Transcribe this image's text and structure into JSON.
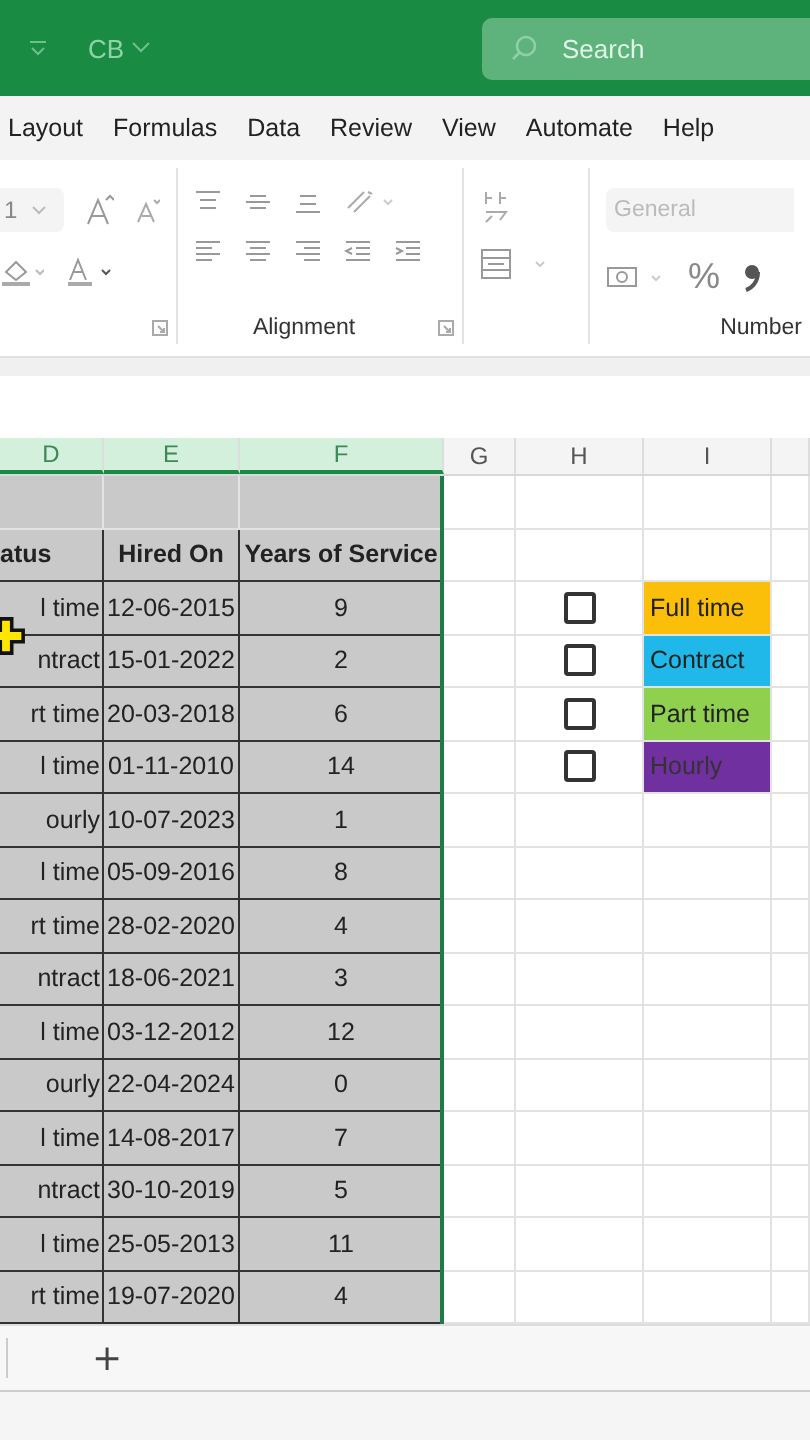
{
  "title_bar": {
    "file_name": "CB",
    "search_placeholder": "Search"
  },
  "ribbon_tabs": [
    {
      "label": "Layout",
      "selected": false
    },
    {
      "label": "Formulas",
      "selected": false
    },
    {
      "label": "Data",
      "selected": false
    },
    {
      "label": "Review",
      "selected": false
    },
    {
      "label": "View",
      "selected": false
    },
    {
      "label": "Automate",
      "selected": false
    },
    {
      "label": "Help",
      "selected": false
    }
  ],
  "ribbon": {
    "font_size": "1",
    "number_format": "General",
    "percent": "%",
    "groups": [
      "Alignment",
      "Number"
    ]
  },
  "column_headers": [
    {
      "label": "D",
      "selected": true
    },
    {
      "label": "E",
      "selected": true
    },
    {
      "label": "F",
      "selected": true
    },
    {
      "label": "G",
      "selected": false
    },
    {
      "label": "H",
      "selected": false
    },
    {
      "label": "I",
      "selected": false
    }
  ],
  "table": {
    "columns": [
      "atus",
      "Hired On",
      "Years of Service"
    ],
    "rows": [
      [
        "l time",
        "12-06-2015",
        "9"
      ],
      [
        "ntract",
        "15-01-2022",
        "2"
      ],
      [
        "rt time",
        "20-03-2018",
        "6"
      ],
      [
        "l time",
        "01-11-2010",
        "14"
      ],
      [
        "ourly",
        "10-07-2023",
        "1"
      ],
      [
        "l time",
        "05-09-2016",
        "8"
      ],
      [
        "rt time",
        "28-02-2020",
        "4"
      ],
      [
        "ntract",
        "18-06-2021",
        "3"
      ],
      [
        "l time",
        "03-12-2012",
        "12"
      ],
      [
        "ourly",
        "22-04-2024",
        "0"
      ],
      [
        "l time",
        "14-08-2017",
        "7"
      ],
      [
        "ntract",
        "30-10-2019",
        "5"
      ],
      [
        "l time",
        "25-05-2013",
        "11"
      ],
      [
        "rt time",
        "19-07-2020",
        "4"
      ]
    ]
  },
  "legend": [
    {
      "label": "Full time",
      "color": "#fbbf0a",
      "checked": false
    },
    {
      "label": "Contract",
      "color": "#1fb8e8",
      "checked": false
    },
    {
      "label": "Part time",
      "color": "#8fd14f",
      "checked": false
    },
    {
      "label": "Hourly",
      "color": "#7030a0",
      "checked": false
    }
  ],
  "sheet_bar": {
    "add_label": "+"
  }
}
